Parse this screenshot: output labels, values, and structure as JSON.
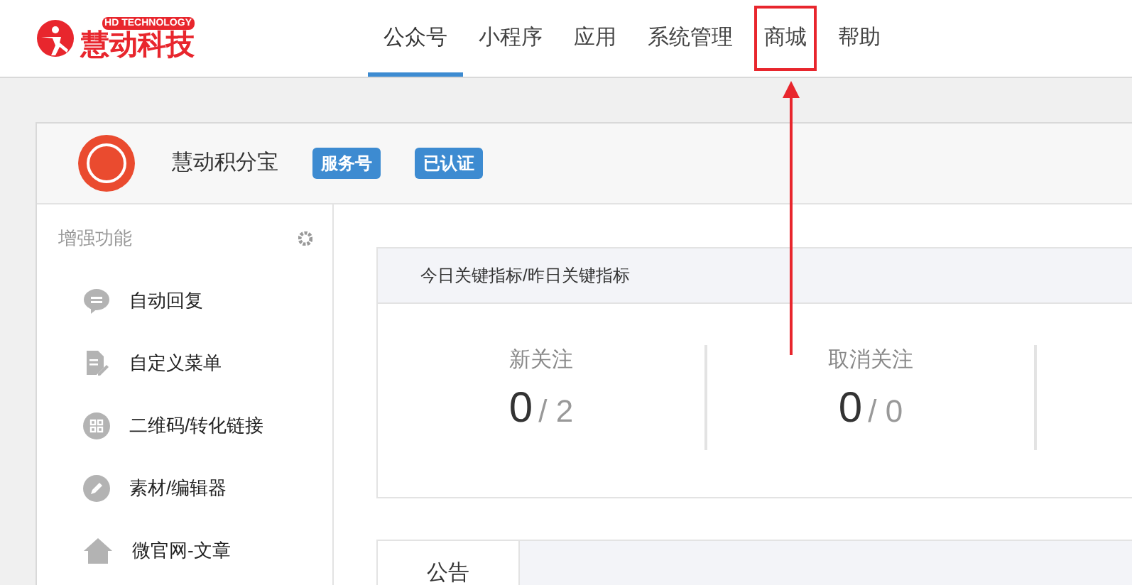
{
  "logo": {
    "tagline": "HD TECHNOLOGY",
    "name": "慧动科技"
  },
  "nav": [
    {
      "label": "公众号",
      "selected": true,
      "highlighted": false
    },
    {
      "label": "小程序",
      "selected": false,
      "highlighted": false
    },
    {
      "label": "应用",
      "selected": false,
      "highlighted": false
    },
    {
      "label": "系统管理",
      "selected": false,
      "highlighted": false
    },
    {
      "label": "商城",
      "selected": false,
      "highlighted": true
    },
    {
      "label": "帮助",
      "selected": false,
      "highlighted": false
    }
  ],
  "account": {
    "name": "慧动积分宝",
    "badges": [
      "服务号",
      "已认证"
    ]
  },
  "sidebar": {
    "title": "增强功能",
    "items": [
      {
        "label": "自动回复",
        "kind": "chat"
      },
      {
        "label": "自定义菜单",
        "kind": "document"
      },
      {
        "label": "二维码/转化链接",
        "kind": "qr"
      },
      {
        "label": "素材/编辑器",
        "kind": "pen"
      },
      {
        "label": "微官网-文章",
        "kind": "home"
      }
    ]
  },
  "metrics": {
    "title": "今日关键指标/昨日关键指标",
    "items": [
      {
        "label": "新关注",
        "today": "0",
        "separator": "/",
        "yesterday": "2"
      },
      {
        "label": "取消关注",
        "today": "0",
        "separator": "/",
        "yesterday": "0"
      }
    ]
  },
  "tabs": [
    {
      "label": "公告",
      "selected": true
    }
  ]
}
